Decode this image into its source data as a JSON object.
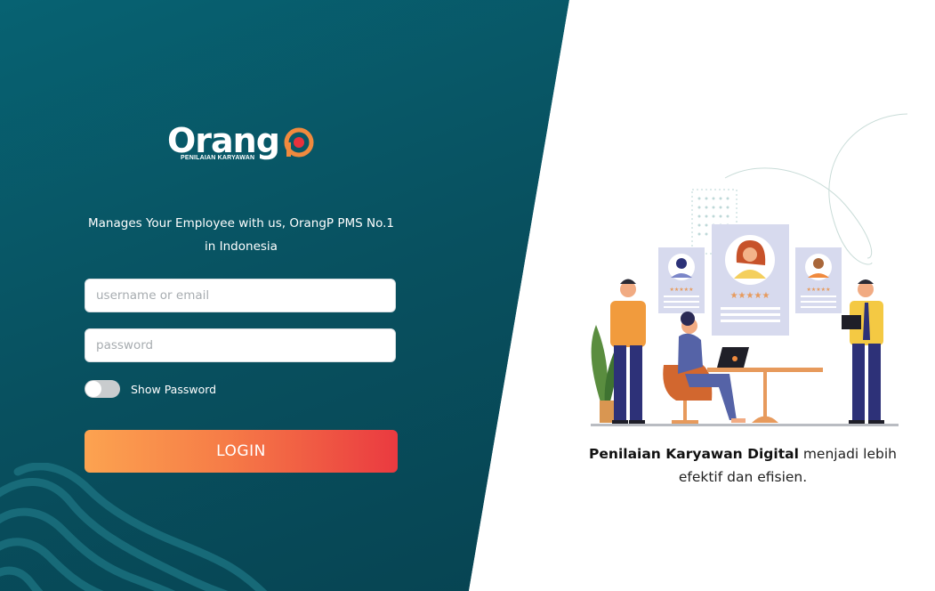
{
  "brand": {
    "name": "Orang",
    "subtitle": "PENILAIAN KARYAWAN",
    "accent_color": "#f08a3e",
    "mark_icon": "p-circle-logo-mark"
  },
  "login": {
    "tagline": "Manages Your Employee with us, OrangP PMS No.1 in Indonesia",
    "username": {
      "placeholder": "username or email",
      "value": ""
    },
    "password": {
      "placeholder": "password",
      "value": ""
    },
    "show_password": {
      "label": "Show Password",
      "checked": false
    },
    "submit_label": "LOGIN"
  },
  "promo": {
    "caption_bold": "Penilaian Karyawan Digital",
    "caption_rest": " menjadi lebih efektif dan efisien."
  },
  "colors": {
    "panel_dark": "#08505f",
    "button_start": "#fca350",
    "button_end": "#ea3a40"
  }
}
